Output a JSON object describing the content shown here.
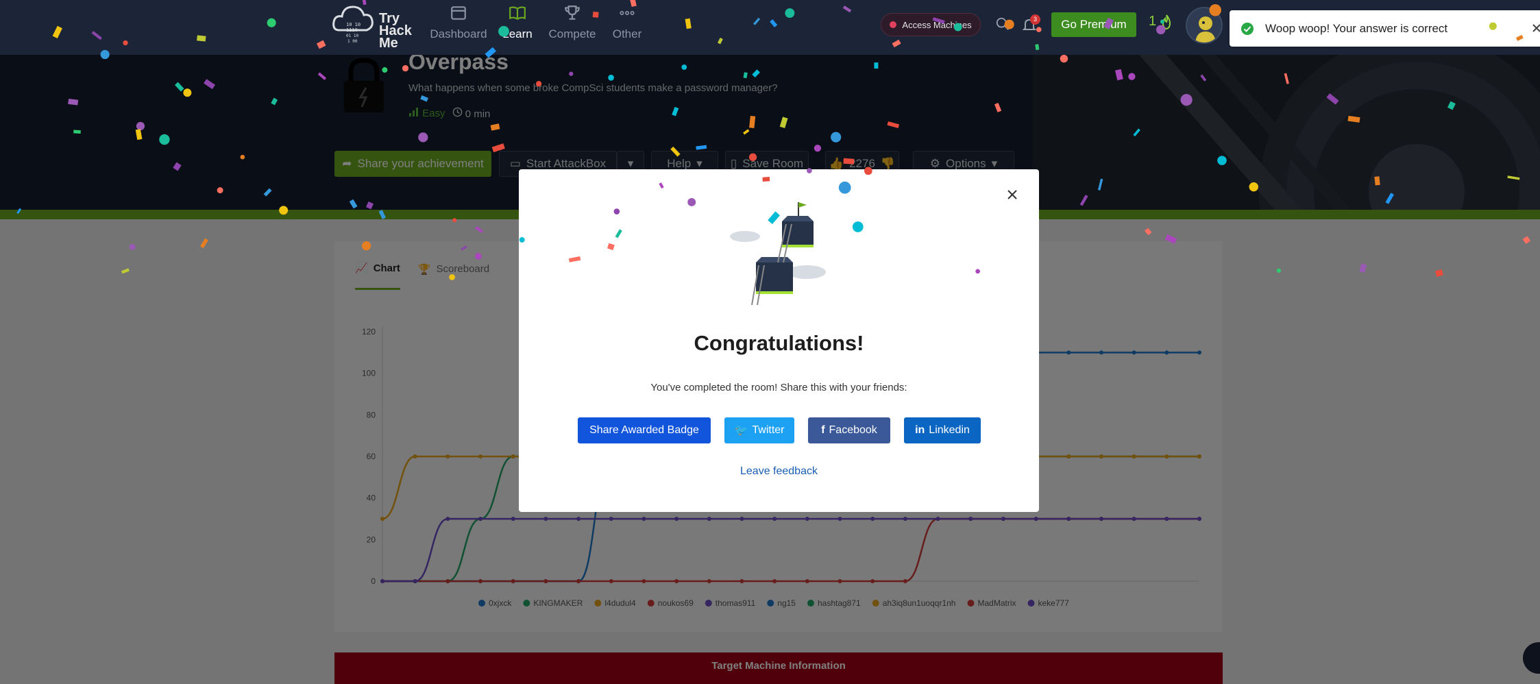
{
  "nav": {
    "logo_lines": [
      "Try",
      "Hack",
      "Me"
    ],
    "items": [
      {
        "label": "Dashboard",
        "icon": "dashboard-icon",
        "active": false
      },
      {
        "label": "Learn",
        "icon": "book-icon",
        "active": true
      },
      {
        "label": "Compete",
        "icon": "trophy-icon",
        "active": false
      },
      {
        "label": "Other",
        "icon": "more-icon",
        "active": false
      }
    ],
    "access_machines": "Access Machines",
    "notification_count": "3",
    "go_premium": "Go Premium",
    "streak": "1"
  },
  "room": {
    "title": "Overpass",
    "description": "What happens when some broke CompSci students make a password manager?",
    "difficulty": "Easy",
    "duration": "0 min",
    "buttons": {
      "share": "Share your achievement",
      "start_attackbox": "Start AttackBox",
      "help": "Help",
      "save_room": "Save Room",
      "likes": "2276",
      "options": "Options"
    }
  },
  "content": {
    "tabs": [
      {
        "label": "Chart",
        "active": true
      },
      {
        "label": "Scoreboard",
        "active": false
      }
    ],
    "target_machine": "Target Machine Information"
  },
  "chart_data": {
    "type": "line",
    "ylim": [
      0,
      120
    ],
    "yticks": [
      0,
      20,
      40,
      60,
      80,
      100,
      120
    ],
    "grid": false,
    "legend_position": "bottom",
    "series": [
      {
        "name": "0xjxck",
        "color": "#1f77c7",
        "values": [
          0,
          0,
          0,
          0,
          0,
          0,
          0,
          60,
          60,
          60,
          60,
          60,
          60,
          60,
          60,
          60,
          60,
          60,
          60,
          60,
          110,
          110,
          110,
          110,
          110,
          110
        ]
      },
      {
        "name": "KINGMAKER",
        "color": "#21a366",
        "values": [
          0,
          0,
          0,
          30,
          60,
          60,
          60,
          60,
          60,
          60,
          60,
          60,
          60,
          60,
          60,
          60,
          60,
          60,
          60,
          60,
          60,
          60,
          60,
          60,
          60,
          60
        ]
      },
      {
        "name": "l4dudul4",
        "color": "#e5a11c",
        "values": [
          30,
          60,
          60,
          60,
          60,
          60,
          60,
          60,
          60,
          60,
          60,
          60,
          60,
          60,
          60,
          60,
          60,
          60,
          60,
          60,
          60,
          60,
          60,
          60,
          60,
          60
        ]
      },
      {
        "name": "noukos69",
        "color": "#d13a3a",
        "values": [
          0,
          0,
          0,
          0,
          0,
          0,
          0,
          0,
          0,
          0,
          0,
          0,
          0,
          0,
          0,
          0,
          0,
          30,
          30,
          30,
          30,
          30,
          30,
          30,
          30,
          30
        ]
      },
      {
        "name": "thomas911",
        "color": "#6a4bc2",
        "values": [
          0,
          0,
          30,
          30,
          30,
          30,
          30,
          30,
          30,
          30,
          30,
          30,
          30,
          30,
          30,
          30,
          30,
          30,
          30,
          30,
          30,
          30,
          30,
          30,
          30,
          30
        ]
      }
    ],
    "legend": [
      {
        "name": "0xjxck",
        "color": "#1f77c7"
      },
      {
        "name": "KINGMAKER",
        "color": "#21a366"
      },
      {
        "name": "l4dudul4",
        "color": "#e5a11c"
      },
      {
        "name": "noukos69",
        "color": "#d13a3a"
      },
      {
        "name": "thomas911",
        "color": "#6a4bc2"
      },
      {
        "name": "ng15",
        "color": "#1f77c7"
      },
      {
        "name": "hashtag871",
        "color": "#21a366"
      },
      {
        "name": "ah3iq8un1uoqqr1nh",
        "color": "#e5a11c"
      },
      {
        "name": "MadMatrix",
        "color": "#d13a3a"
      },
      {
        "name": "keke777",
        "color": "#6a4bc2"
      }
    ]
  },
  "modal": {
    "title": "Congratulations!",
    "subtitle": "You've completed the room! Share this with your friends:",
    "buttons": {
      "badge": "Share Awarded Badge",
      "twitter": "Twitter",
      "facebook": "Facebook",
      "linkedin": "Linkedin"
    },
    "feedback": "Leave feedback"
  },
  "toast": {
    "message": "Woop woop! Your answer is correct"
  },
  "colors": {
    "nav_bg": "#1c2538",
    "accent_green": "#6ba81f",
    "badge_blue": "#1155dd",
    "twitter_blue": "#1da1f2",
    "facebook_blue": "#3b5998",
    "linkedin_blue": "#0a66c2",
    "target_red": "#a10014"
  }
}
